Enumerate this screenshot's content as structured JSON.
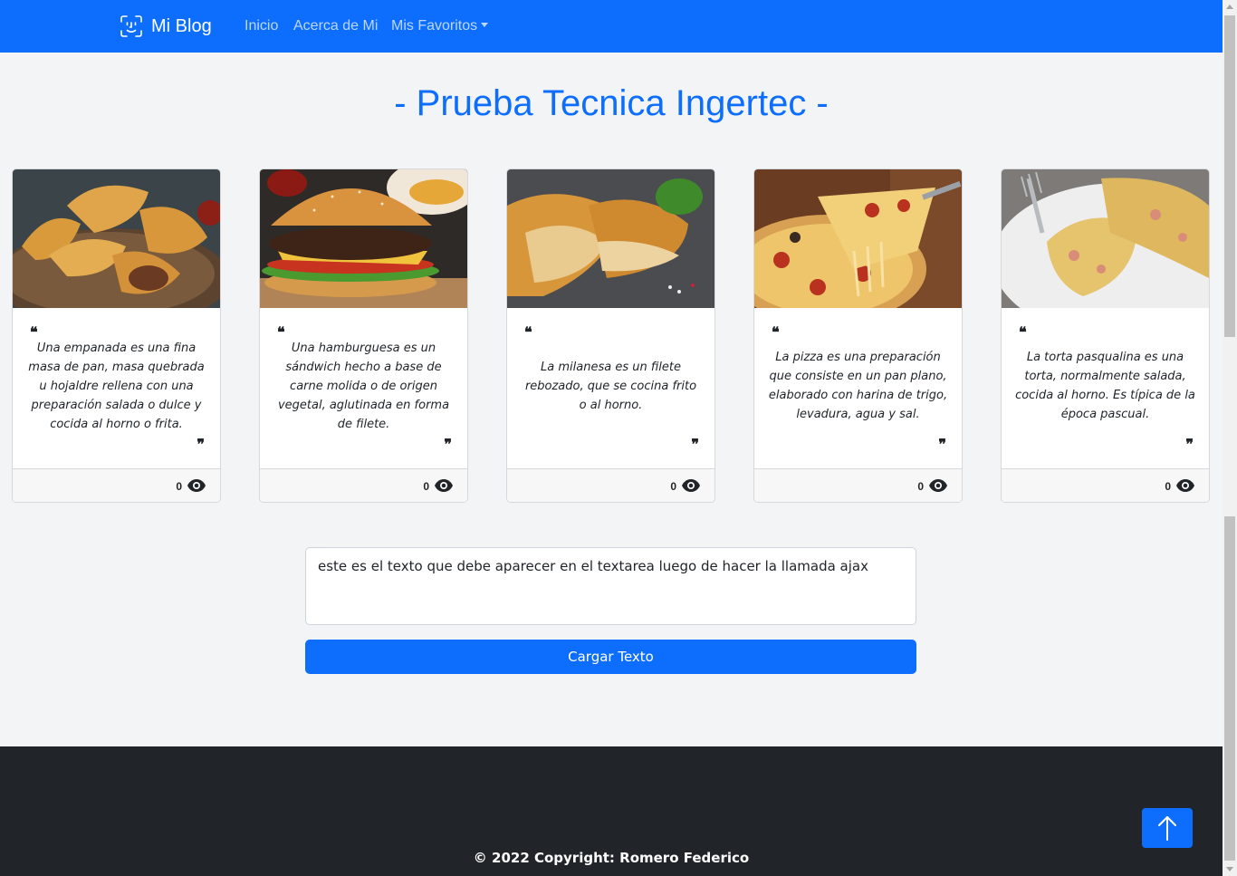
{
  "navbar": {
    "brand": "Mi Blog",
    "brand_icon": "face-id-icon",
    "links": [
      "Inicio",
      "Acerca de Mi",
      "Mis Favoritos"
    ]
  },
  "page_title": "- Prueba Tecnica Ingertec -",
  "cards": [
    {
      "text": "Una empanada es una fina masa de pan, masa quebrada u hojaldre rellena con una preparación salada o dulce y cocida al horno o frita.",
      "views": "0",
      "image": "empanadas"
    },
    {
      "text": "Una hamburguesa es un sándwich hecho a base de carne molida o de origen vegetal, aglutinada en forma de filete.",
      "views": "0",
      "image": "hamburguesa"
    },
    {
      "text": "La milanesa es un filete rebozado, que se cocina frito o al horno.",
      "views": "0",
      "image": "milanesa"
    },
    {
      "text": "La pizza es una preparación que consiste en un pan plano, elaborado con harina de trigo, levadura, agua y sal.",
      "views": "0",
      "image": "pizza"
    },
    {
      "text": "La torta pasqualina es una torta, normalmente salada, cocida al horno. Es típica de la época pascual.",
      "views": "0",
      "image": "torta-pasqualina"
    }
  ],
  "form": {
    "textarea_value": "este es el texto que debe aparecer en el textarea luego de hacer la llamada ajax",
    "button_label": "Cargar Texto"
  },
  "footer": {
    "copyright": "© 2022 Copyright: Romero Federico"
  },
  "colors": {
    "primary": "#0d6efd",
    "footer_bg": "#212529",
    "page_bg": "#f3f4f6"
  }
}
